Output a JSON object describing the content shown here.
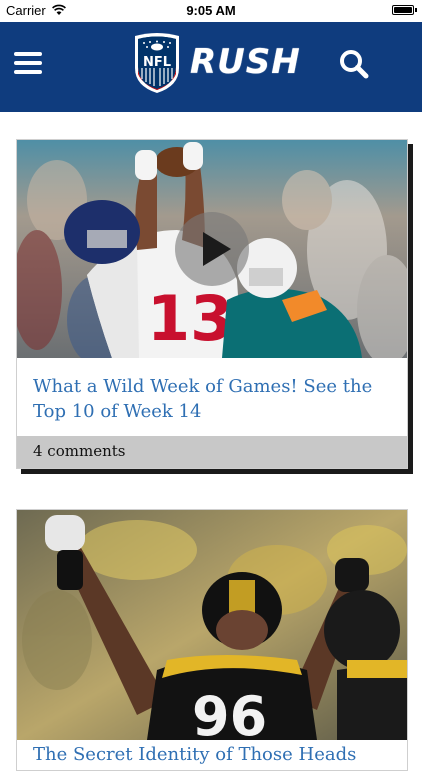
{
  "status_bar": {
    "carrier": "Carrier",
    "time": "9:05 AM"
  },
  "header": {
    "logo_text": "NFL",
    "brand": "RUSH",
    "background_color": "#0f3c7e"
  },
  "articles": [
    {
      "title": "What a Wild Week of Games! See the Top 10 of Week 14",
      "comments": "4 comments",
      "has_video": true,
      "jersey_number": "13"
    },
    {
      "title": "The Secret Identity of Those Heads",
      "jersey_number": "96"
    }
  ]
}
